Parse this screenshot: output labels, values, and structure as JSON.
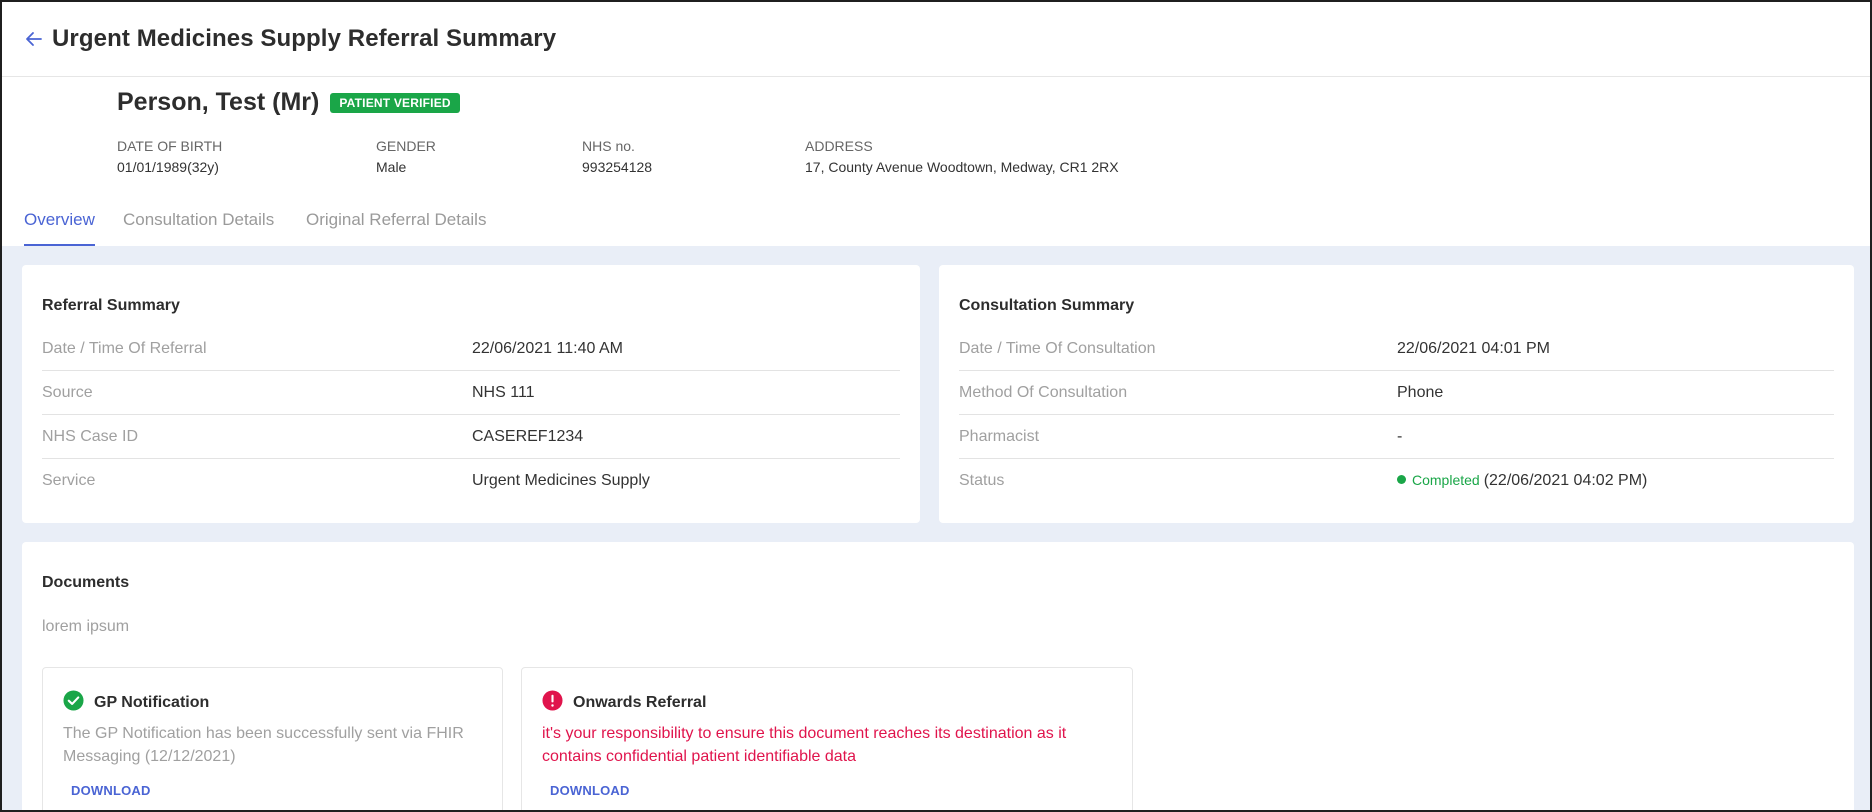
{
  "header": {
    "title": "Urgent Medicines Supply Referral Summary"
  },
  "patient": {
    "name": "Person, Test (Mr)",
    "badge": "PATIENT VERIFIED",
    "fields": [
      {
        "label": "DATE OF BIRTH",
        "value": "01/01/1989(32y)"
      },
      {
        "label": "GENDER",
        "value": "Male"
      },
      {
        "label": "NHS no.",
        "value": "993254128"
      },
      {
        "label": "ADDRESS",
        "value": "17, County Avenue Woodtown, Medway, CR1 2RX"
      }
    ]
  },
  "tabs": [
    {
      "label": "Overview",
      "active": true
    },
    {
      "label": "Consultation Details",
      "active": false
    },
    {
      "label": "Original Referral Details",
      "active": false
    }
  ],
  "referral_summary": {
    "title": "Referral Summary",
    "rows": [
      {
        "label": "Date / Time Of Referral",
        "value": "22/06/2021 11:40 AM"
      },
      {
        "label": "Source",
        "value": "NHS 111"
      },
      {
        "label": "NHS Case ID",
        "value": "CASEREF1234"
      },
      {
        "label": "Service",
        "value": "Urgent Medicines Supply"
      }
    ]
  },
  "consultation_summary": {
    "title": "Consultation Summary",
    "rows": [
      {
        "label": "Date / Time Of Consultation",
        "value": "22/06/2021 04:01 PM"
      },
      {
        "label": "Method Of Consultation",
        "value": "Phone"
      },
      {
        "label": "Pharmacist",
        "value": "-"
      },
      {
        "label": "Status",
        "status": "Completed",
        "time": "(22/06/2021 04:02 PM)"
      }
    ]
  },
  "documents": {
    "title": "Documents",
    "subtitle": "lorem ipsum",
    "items": [
      {
        "title": "GP Notification",
        "icon": "check-circle-icon",
        "description": "The GP Notification has been successfully sent via FHIR Messaging (12/12/2021)",
        "download": "DOWNLOAD"
      },
      {
        "title": "Onwards Referral",
        "icon": "alert-circle-icon",
        "description": "it's your responsibility to ensure this document reaches its destination as it contains confidential patient identifiable data",
        "download": "DOWNLOAD"
      }
    ]
  },
  "colors": {
    "accent": "#4a64d4",
    "success": "#1aa648",
    "danger": "#e0144c",
    "background": "#e9eef7"
  }
}
